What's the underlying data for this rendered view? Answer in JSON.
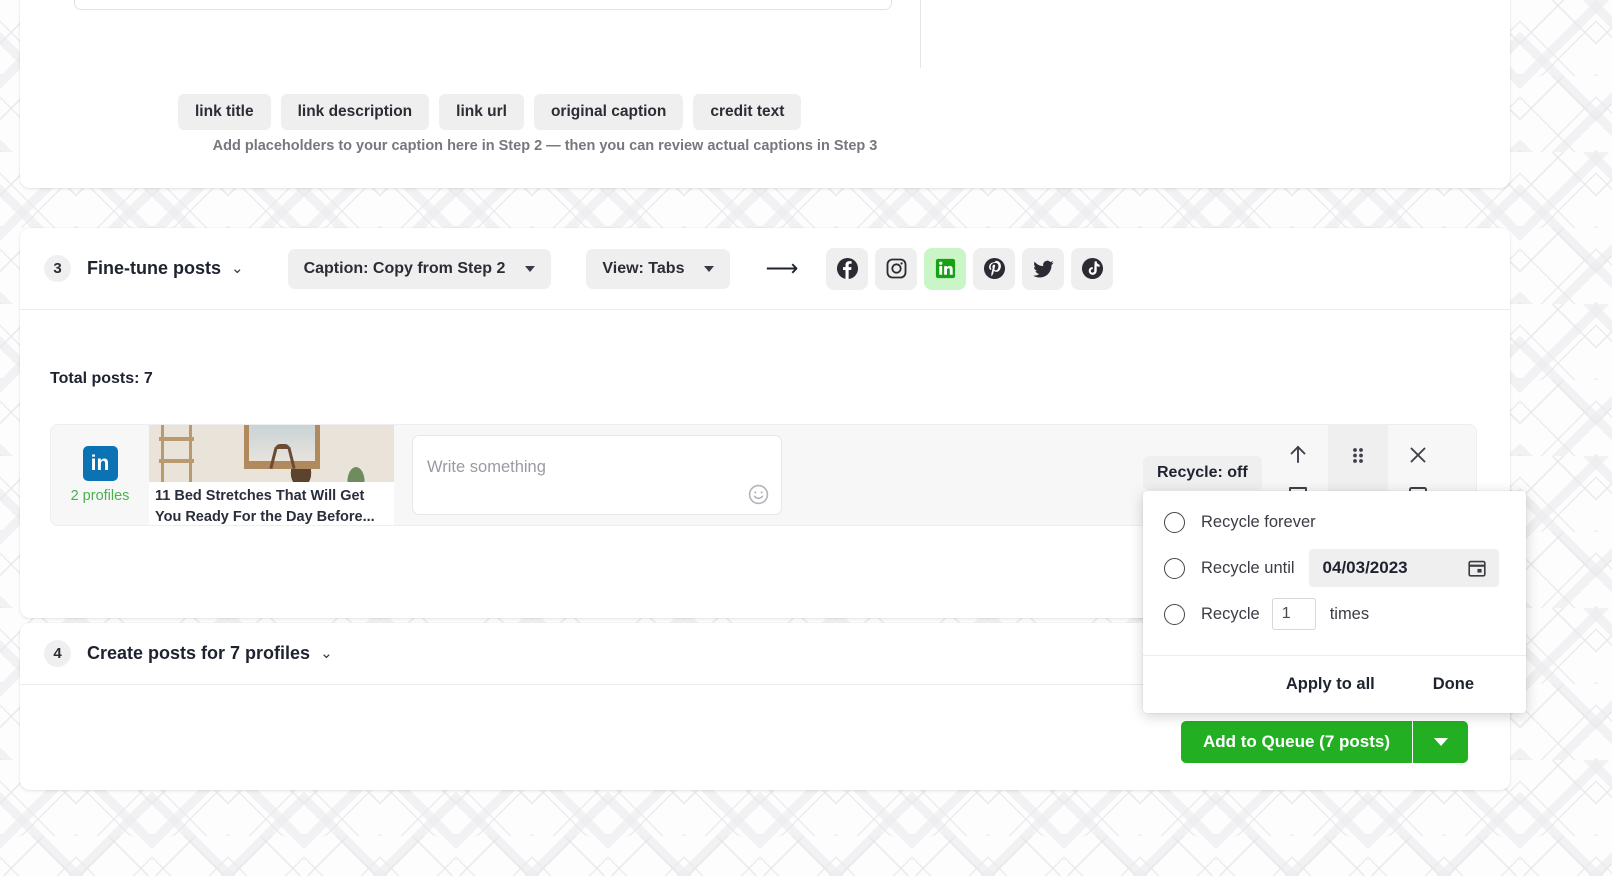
{
  "step2": {
    "caption_placeholder": "",
    "emoji_icon": "emoji-smiley-icon",
    "chips": [
      {
        "label": "link title"
      },
      {
        "label": "link description"
      },
      {
        "label": "link url"
      },
      {
        "label": "original caption"
      },
      {
        "label": "credit text"
      }
    ],
    "hint": "Add placeholders to your caption here in Step 2 — then you can review actual captions in Step 3"
  },
  "step3": {
    "number": "3",
    "title": "Fine-tune posts",
    "chevron": "⌄",
    "caption_dropdown": "Caption: Copy from Step 2",
    "view_dropdown": "View: Tabs",
    "arrow": "⟶",
    "networks": [
      {
        "name": "facebook",
        "active": false
      },
      {
        "name": "instagram",
        "active": false
      },
      {
        "name": "linkedin",
        "active": true
      },
      {
        "name": "pinterest",
        "active": false
      },
      {
        "name": "twitter",
        "active": false
      },
      {
        "name": "tiktok",
        "active": false
      }
    ],
    "total_posts": "Total posts: 7",
    "post": {
      "network_logo": "linkedin-logo",
      "logo_text": "in",
      "profiles_count": "2 profiles",
      "thumb_title": "11 Bed Stretches That Will Get You Ready For the Day Before...",
      "write_placeholder": "Write something",
      "emoji_icon": "emoji-smiley-icon",
      "actions": [
        {
          "name": "upload-icon"
        },
        {
          "name": "drag-handle-icon"
        },
        {
          "name": "close-icon"
        }
      ]
    },
    "recycle": {
      "pill_label": "Recycle: off",
      "options": [
        {
          "label": "Recycle forever",
          "selected": false
        },
        {
          "label": "Recycle until",
          "selected": false
        },
        {
          "label": "Recycle",
          "selected": false
        }
      ],
      "date_value": "04/03/2023",
      "calendar_icon": "calendar-icon",
      "times_value": "1",
      "times_label": "times",
      "apply_all_label": "Apply to all",
      "done_label": "Done"
    }
  },
  "step4": {
    "number": "4",
    "title": "Create posts for 7 profiles",
    "chevron": "⌄",
    "add_to_queue_label": "Add to Queue (7 posts)",
    "queue_caret_icon": "caret-down-icon"
  },
  "colors": {
    "brand_green": "#22b022",
    "active_tab_bg": "#c9f5c7",
    "linkedin_blue": "#0b72b4",
    "profiles_green": "#4caf50"
  }
}
